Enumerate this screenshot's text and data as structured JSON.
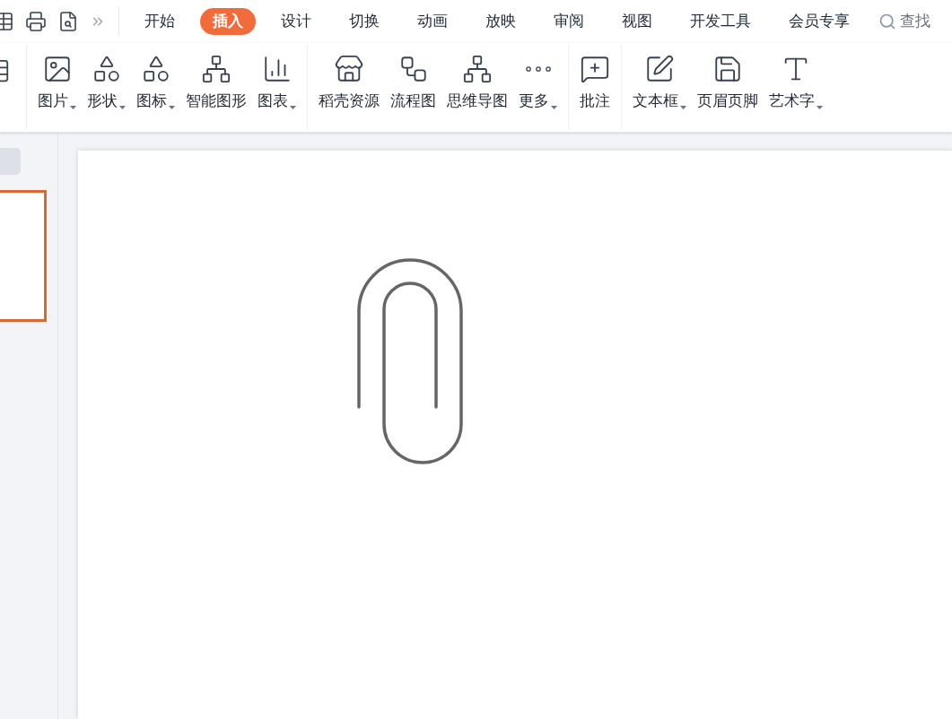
{
  "tabs": [
    {
      "label": "开始",
      "selected": false
    },
    {
      "label": "插入",
      "selected": true
    },
    {
      "label": "设计",
      "selected": false
    },
    {
      "label": "切换",
      "selected": false
    },
    {
      "label": "动画",
      "selected": false
    },
    {
      "label": "放映",
      "selected": false
    },
    {
      "label": "审阅",
      "selected": false
    },
    {
      "label": "视图",
      "selected": false
    },
    {
      "label": "开发工具",
      "selected": false
    },
    {
      "label": "会员专享",
      "selected": false
    }
  ],
  "search": {
    "placeholder": "查找"
  },
  "ribbon_groups": [
    [
      {
        "kind": "picture",
        "label": "图片",
        "dropdown": true
      },
      {
        "kind": "shapes",
        "label": "形状",
        "dropdown": true
      },
      {
        "kind": "icons",
        "label": "图标",
        "dropdown": true
      },
      {
        "kind": "smartart",
        "label": "智能图形",
        "dropdown": false
      },
      {
        "kind": "chart",
        "label": "图表",
        "dropdown": true
      }
    ],
    [
      {
        "kind": "store",
        "label": "稻壳资源",
        "dropdown": false
      },
      {
        "kind": "flow",
        "label": "流程图",
        "dropdown": false
      },
      {
        "kind": "mindmap",
        "label": "思维导图",
        "dropdown": false
      },
      {
        "kind": "more",
        "label": "更多",
        "dropdown": true
      }
    ],
    [
      {
        "kind": "comment",
        "label": "批注",
        "dropdown": false
      }
    ],
    [
      {
        "kind": "textbox",
        "label": "文本框",
        "dropdown": true
      },
      {
        "kind": "headerfooter",
        "label": "页眉页脚",
        "dropdown": false
      },
      {
        "kind": "wordart",
        "label": "艺术字",
        "dropdown": true
      }
    ]
  ]
}
